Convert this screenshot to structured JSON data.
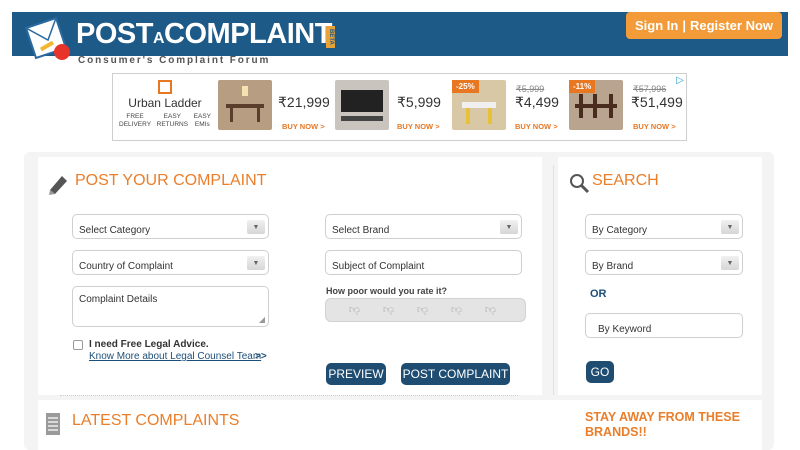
{
  "header": {
    "logo_main": "POST",
    "logo_a": "A",
    "logo_rest": "COMPLAINT",
    "beta": "BETA",
    "tagline": "Consumer's Complaint Forum",
    "sign_in": "Sign In",
    "separator": "|",
    "register": "Register Now"
  },
  "ad": {
    "brand": "Urban Ladder",
    "features": [
      "FREE\nDELIVERY",
      "EASY\nRETURNS",
      "EASY\nEMIs"
    ],
    "items": [
      {
        "price": "₹21,999",
        "old_price": "",
        "discount": "",
        "buy": "BUY NOW >"
      },
      {
        "price": "₹5,999",
        "old_price": "",
        "discount": "",
        "buy": "BUY NOW >"
      },
      {
        "price": "₹4,499",
        "old_price": "₹5,999",
        "discount": "-25%",
        "buy": "BUY NOW >"
      },
      {
        "price": "₹51,499",
        "old_price": "₹57,996",
        "discount": "-11%",
        "buy": "BUY NOW >"
      }
    ]
  },
  "post": {
    "title": "POST YOUR COMPLAINT",
    "select_category": "Select Category",
    "select_brand": "Select Brand",
    "country": "Country of Complaint",
    "subject_placeholder": "Subject of Complaint",
    "details_placeholder": "Complaint Details",
    "rating_label": "How poor would you rate it?",
    "legal_label": "I need Free Legal Advice.",
    "legal_link": "Know More about Legal Counsel Team",
    "legal_arrow": ">>",
    "preview": "PREVIEW",
    "submit": "POST COMPLAINT"
  },
  "search": {
    "title": "SEARCH",
    "by_category": "By Category",
    "by_brand": "By Brand",
    "or": "OR",
    "keyword_placeholder": "By Keyword",
    "go": "GO"
  },
  "latest": {
    "title": "LATEST COMPLAINTS"
  },
  "stay_away": {
    "line1": "STAY AWAY FROM THESE",
    "line2": "BRANDS!!"
  },
  "colors": {
    "header_bg": "#1d5a87",
    "accent_orange": "#ea7e2a",
    "button_dark": "#1f4d72"
  }
}
